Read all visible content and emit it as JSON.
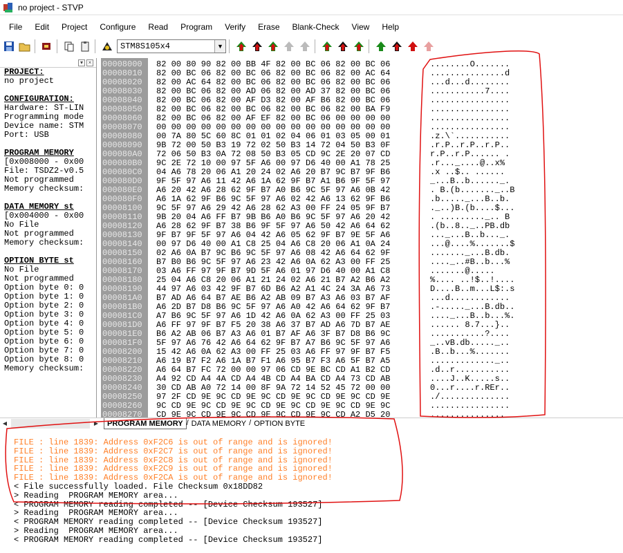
{
  "title": "no project - STVP",
  "menu": [
    "File",
    "Edit",
    "Project",
    "Configure",
    "Read",
    "Program",
    "Verify",
    "Erase",
    "Blank-Check",
    "View",
    "Help"
  ],
  "toolbar": {
    "device": "STM8S105x4"
  },
  "left_panel": {
    "rows": [
      {
        "text": "PROJECT:",
        "bold": true
      },
      {
        "text": "no project",
        "bold": false
      },
      {
        "text": "",
        "bold": false
      },
      {
        "text": "CONFIGURATION:",
        "bold": true
      },
      {
        "text": "Hardware: ST-LIN",
        "bold": false
      },
      {
        "text": "Programming mode",
        "bold": false
      },
      {
        "text": "Device name: STM",
        "bold": false
      },
      {
        "text": "Port: USB",
        "bold": false
      },
      {
        "text": "",
        "bold": false
      },
      {
        "text": "PROGRAM MEMORY",
        "bold": true
      },
      {
        "text": "[0x008000 - 0x00",
        "bold": false
      },
      {
        "text": "File: TSDZ2-v0.5",
        "bold": false
      },
      {
        "text": "Not programmed",
        "bold": false
      },
      {
        "text": "Memory checksum:",
        "bold": false
      },
      {
        "text": "",
        "bold": false
      },
      {
        "text": "DATA MEMORY st",
        "bold": true
      },
      {
        "text": "[0x004000 - 0x00",
        "bold": false
      },
      {
        "text": "No File",
        "bold": false
      },
      {
        "text": "Not programmed",
        "bold": false
      },
      {
        "text": "Memory checksum:",
        "bold": false
      },
      {
        "text": "",
        "bold": false
      },
      {
        "text": "OPTION BYTE st",
        "bold": true
      },
      {
        "text": "No File",
        "bold": false
      },
      {
        "text": "Not programmed",
        "bold": false
      },
      {
        "text": "Option byte 0: 0",
        "bold": false
      },
      {
        "text": "Option byte 1: 0",
        "bold": false
      },
      {
        "text": "Option byte 2: 0",
        "bold": false
      },
      {
        "text": "Option byte 3: 0",
        "bold": false
      },
      {
        "text": "Option byte 4: 0",
        "bold": false
      },
      {
        "text": "Option byte 5: 0",
        "bold": false
      },
      {
        "text": "Option byte 6: 0",
        "bold": false
      },
      {
        "text": "Option byte 7: 0",
        "bold": false
      },
      {
        "text": "Option byte 8: 0",
        "bold": false
      },
      {
        "text": "Memory checksum:",
        "bold": false
      }
    ]
  },
  "hex_rows": [
    [
      "00008000",
      "82 00 80 90 82 00 BB 4F 82 00 BC 06 82 00 BC 06",
      "........O......."
    ],
    [
      "00008010",
      "82 00 BC 06 82 00 BC 06 82 00 BC 06 82 00 AC 64",
      "...............d"
    ],
    [
      "00008020",
      "82 00 AC 64 82 00 BC 06 82 00 BC 06 82 00 BC 06",
      "...d...d........"
    ],
    [
      "00008030",
      "82 00 BC 06 82 00 AD 06 82 00 AD 37 82 00 BC 06",
      "...........7...."
    ],
    [
      "00008040",
      "82 00 BC 06 82 00 AF D3 82 00 AF B6 82 00 BC 06",
      "................"
    ],
    [
      "00008050",
      "82 00 BC 06 82 00 BC 06 82 00 BC 06 82 00 BA F9",
      "................"
    ],
    [
      "00008060",
      "82 00 BC 06 82 00 AF EF 82 00 BC 06 00 00 00 00",
      "................"
    ],
    [
      "00008070",
      "00 00 00 00 00 00 00 00 00 00 00 00 00 00 00 00",
      "................"
    ],
    [
      "00008080",
      "00 7A 80 5C 60 8C 01 01 02 04 06 01 03 05 00 01",
      ".z.\\`..........."
    ],
    [
      "00008090",
      "9B 72 00 50 B3 19 72 02 50 B3 14 72 04 50 B3 0F",
      ".r.P..r.P..r.P.."
    ],
    [
      "000080A0",
      "72 06 50 B3 0A 72 08 50 B3 05 CD 9C 2E 20 07 CD",
      "r.P..r.P...... ."
    ],
    [
      "000080B0",
      "9C 2E 72 10 00 97 5F A6 00 97 D6 40 00 A1 78 25",
      ".r..._....@..x%"
    ],
    [
      "000080C0",
      "04 A6 78 20 06 A1 20 24 02 A6 20 B7 9C B7 9F B6",
      ".x ..$.. ......"
    ],
    [
      "000080D0",
      "9F 5F 97 A6 11 42 A6 1A 62 9F B7 A1 B6 9F 5F 97",
      "_...B..b......_."
    ],
    [
      "000080E0",
      "A6 20 42 A6 28 62 9F B7 A0 B6 9C 5F 97 A6 0B 42",
      ". B.(b......._..B"
    ],
    [
      "000080F0",
      "A6 1A 62 9F B6 9C 5F 97 A6 02 42 A6 13 62 9F B6",
      ".b....._...B..b."
    ],
    [
      "00008100",
      "9C 5F 97 A6 29 42 A6 28 62 A3 00 FF 24 05 9F B7",
      "._..)B.(b....$..."
    ],
    [
      "00008110",
      "9B 20 04 A6 FF B7 9B B6 A0 B6 9C 5F 97 A6 20 42",
      ". ........._.. B"
    ],
    [
      "00008120",
      "A6 28 62 9F B7 38 B6 9F 5F 97 A6 50 42 A6 64 62",
      ".(b..8.._..PB.db"
    ],
    [
      "00008130",
      "9F B7 9F 5F 97 A6 04 42 A6 05 62 9F B7 9E 5F A6",
      "..._...B..b..._."
    ],
    [
      "00008140",
      "00 97 D6 40 00 A1 C8 25 04 A6 C8 20 06 A1 0A 24",
      "...@....%.......$"
    ],
    [
      "00008150",
      "02 A6 0A B7 9C B6 9C 5F 97 A6 08 42 A6 64 62 9F",
      "......._...B.db."
    ],
    [
      "00008160",
      "B7 B0 B6 9C 5F 97 A6 23 42 A6 0A 62 A3 00 FF 25",
      "...._..#B..b...%"
    ],
    [
      "00008170",
      "03 A6 FF 97 9F B7 9D 5F A6 01 97 D6 40 00 A1 C8",
      ".......@....."
    ],
    [
      "00008180",
      "25 04 A6 C8 20 06 A1 21 24 02 A6 21 B7 A2 B6 A2",
      "%.... ..!$..!...."
    ],
    [
      "00008190",
      "44 97 A6 03 42 9F B7 6D B6 A2 A1 4C 24 3A A6 73",
      "D....B..m...L$:.s"
    ],
    [
      "000081A0",
      "B7 AD A6 64 B7 AE B6 A2 AB 09 B7 A3 A6 03 B7 AF",
      "...d............"
    ],
    [
      "000081B0",
      "A6 2D B7 D8 B6 9C 5F 97 A6 A0 42 A6 64 62 9F B7",
      ".-....._...B.db.."
    ],
    [
      "000081C0",
      "A7 B6 9C 5F 97 A6 1D 42 A6 0A 62 A3 00 FF 25 03",
      "...._...B..b...%."
    ],
    [
      "000081D0",
      "A6 FF 97 9F B7 F5 20 38 A6 37 B7 AD A6 7D B7 AE",
      "...... 8.7...}.."
    ],
    [
      "000081E0",
      "B6 A2 AB 06 B7 A3 A6 01 B7 AF A6 3F B7 D8 B6 9C",
      "...........?...."
    ],
    [
      "000081F0",
      "5F 97 A6 76 42 A6 64 62 9F B7 A7 B6 9C 5F 97 A6",
      "_..vB.db....._.."
    ],
    [
      "00008200",
      "15 42 A6 0A 62 A3 00 FF 25 03 A6 FF 97 9F B7 F5",
      ".B..b...%......."
    ],
    [
      "00008210",
      "A6 19 B7 F2 A6 1A B7 F1 A6 95 B7 F3 A6 5F B7 A5",
      "............._.."
    ],
    [
      "00008220",
      "A6 64 B7 FC 72 00 00 97 06 CD 9E BC CD A1 B2 CD",
      ".d..r..........."
    ],
    [
      "00008230",
      "A4 92 CD A4 4A CD A4 4B CD A4 BA CD A4 73 CD AB",
      "....J..K.....s.."
    ],
    [
      "00008240",
      "30 CD AB A0 72 14 00 8F 9A 72 14 52 45 72 00 00",
      "0...r....r.REr.."
    ],
    [
      "00008250",
      "97 2F CD 9E 9C CD 9E 9C CD 9E 9C CD 9E 9C CD 9E",
      "./.............."
    ],
    [
      "00008260",
      "9C CD 9E 9C CD 9E 9C CD 9E 9C CD 9E 9C CD 9E 9C",
      "................"
    ],
    [
      "00008270",
      "CD 9E 9C CD 9E 9C CD 9E 9C CD 9E 9C CD A2 D5 20",
      "..............."
    ]
  ],
  "tabs": [
    "PROGRAM MEMORY",
    "DATA MEMORY",
    "OPTION BYTE"
  ],
  "log": [
    {
      "text": "FILE : line 1839: Address 0xF2C6 is out of range and is ignored!",
      "type": "err"
    },
    {
      "text": "FILE : line 1839: Address 0xF2C7 is out of range and is ignored!",
      "type": "err"
    },
    {
      "text": "FILE : line 1839: Address 0xF2C8 is out of range and is ignored!",
      "type": "err"
    },
    {
      "text": "FILE : line 1839: Address 0xF2C9 is out of range and is ignored!",
      "type": "err"
    },
    {
      "text": "FILE : line 1839: Address 0xF2CA is out of range and is ignored!",
      "type": "err"
    },
    {
      "text": "< File successfully loaded. File Checksum 0x18DD82",
      "type": "info"
    },
    {
      "text": "> Reading  PROGRAM MEMORY area...",
      "type": "info"
    },
    {
      "text": "< PROGRAM MEMORY reading completed -- [Device Checksum 193527]",
      "type": "info"
    },
    {
      "text": "> Reading  PROGRAM MEMORY area...",
      "type": "info"
    },
    {
      "text": "< PROGRAM MEMORY reading completed -- [Device Checksum 193527]",
      "type": "info"
    },
    {
      "text": "> Reading  PROGRAM MEMORY area...",
      "type": "info"
    },
    {
      "text": "< PROGRAM MEMORY reading completed -- [Device Checksum 193527]",
      "type": "info"
    }
  ],
  "colors": {
    "error": "#ff7f27",
    "address_bg": "#9c9c9c",
    "annotation": "#e01010"
  }
}
